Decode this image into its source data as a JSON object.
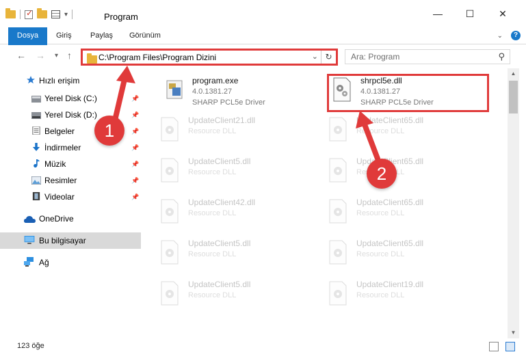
{
  "window": {
    "title": "Program",
    "minimize": "—",
    "maximize": "☐",
    "close": "✕"
  },
  "ribbon": {
    "tabs": [
      "Dosya",
      "Giriş",
      "Paylaş",
      "Görünüm"
    ],
    "help": "?"
  },
  "nav": {
    "back": "←",
    "forward": "→",
    "recent": "▾",
    "up": "↑",
    "address": "C:\\Program Files\\Program Dizini",
    "refresh": "↻",
    "search_placeholder": "Ara: Program"
  },
  "sidebar": {
    "items": [
      {
        "label": "Hızlı erişim",
        "icon": "star-icon"
      },
      {
        "label": "Yerel Disk (C:)",
        "icon": "drive-icon",
        "pinned": true
      },
      {
        "label": "Yerel Disk (D:)",
        "icon": "drive-icon",
        "pinned": true
      },
      {
        "label": "Belgeler",
        "icon": "documents-icon",
        "pinned": true
      },
      {
        "label": "İndirmeler",
        "icon": "download-icon",
        "pinned": true
      },
      {
        "label": "Müzik",
        "icon": "music-icon",
        "pinned": true
      },
      {
        "label": "Resimler",
        "icon": "pictures-icon",
        "pinned": true
      },
      {
        "label": "Videolar",
        "icon": "videos-icon",
        "pinned": true
      },
      {
        "label": "OneDrive",
        "icon": "cloud-icon"
      },
      {
        "label": "Bu bilgisayar",
        "icon": "computer-icon",
        "selected": true
      },
      {
        "label": "Ağ",
        "icon": "network-icon"
      }
    ]
  },
  "files": {
    "left": [
      {
        "name": "program.exe",
        "version": "4.0.1381.27",
        "desc": "SHARP PCL5e Driver"
      },
      {
        "name": "UpdateClient21.dll",
        "version": "Resource DLL",
        "desc": ""
      },
      {
        "name": "UpdateClient5.dll",
        "version": "Resource DLL",
        "desc": ""
      },
      {
        "name": "UpdateClient42.dll",
        "version": "Resource DLL",
        "desc": ""
      },
      {
        "name": "UpdateClient5.dll",
        "version": "Resource DLL",
        "desc": ""
      },
      {
        "name": "UpdateClient5.dll",
        "version": "Resource DLL",
        "desc": ""
      }
    ],
    "right": [
      {
        "name": "shrpcl5e.dll",
        "version": "4.0.1381.27",
        "desc": "SHARP PCL5e Driver"
      },
      {
        "name": "UpdateClient65.dll",
        "version": "Resource DLL",
        "desc": ""
      },
      {
        "name": "UpdateClient65.dll",
        "version": "Resource DLL",
        "desc": ""
      },
      {
        "name": "UpdateClient65.dll",
        "version": "Resource DLL",
        "desc": ""
      },
      {
        "name": "UpdateClient65.dll",
        "version": "Resource DLL",
        "desc": ""
      },
      {
        "name": "UpdateClient19.dll",
        "version": "Resource DLL",
        "desc": ""
      }
    ]
  },
  "status": {
    "count": "123 öğe"
  },
  "annotations": {
    "badge1": "1",
    "badge2": "2",
    "color": "#e03a3a"
  }
}
